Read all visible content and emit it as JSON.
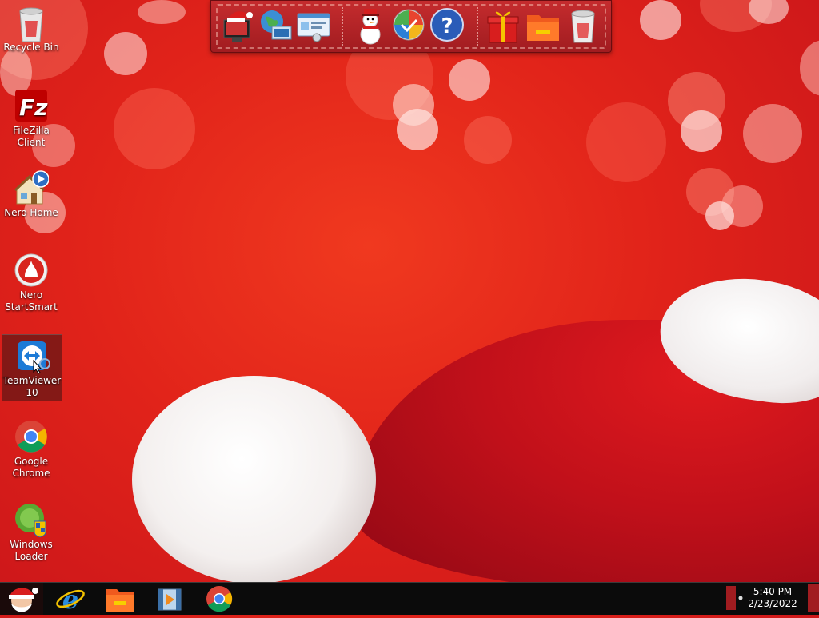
{
  "desktop": {
    "icons": [
      {
        "label": "Recycle Bin"
      },
      {
        "label": "FileZilla Client"
      },
      {
        "label": "Nero Home"
      },
      {
        "label": "Nero StartSmart"
      },
      {
        "label": "TeamViewer 10"
      },
      {
        "label": "Google Chrome"
      },
      {
        "label": "Windows Loader"
      }
    ]
  },
  "dock": {
    "items": [
      "santa-computer-icon",
      "globe-network-icon",
      "control-panel-icon",
      "snowman-icon",
      "windows-update-icon",
      "help-icon",
      "gift-icon",
      "folder-icon",
      "recycle-bin-icon"
    ]
  },
  "taskbar": {
    "pinned": [
      "internet-explorer-icon",
      "file-explorer-icon",
      "media-player-icon",
      "chrome-icon"
    ],
    "clock": {
      "time": "5:40 PM",
      "date": "2/23/2022"
    }
  },
  "colors": {
    "accent": "#e1231a",
    "taskbar": "#0b0b0b"
  }
}
